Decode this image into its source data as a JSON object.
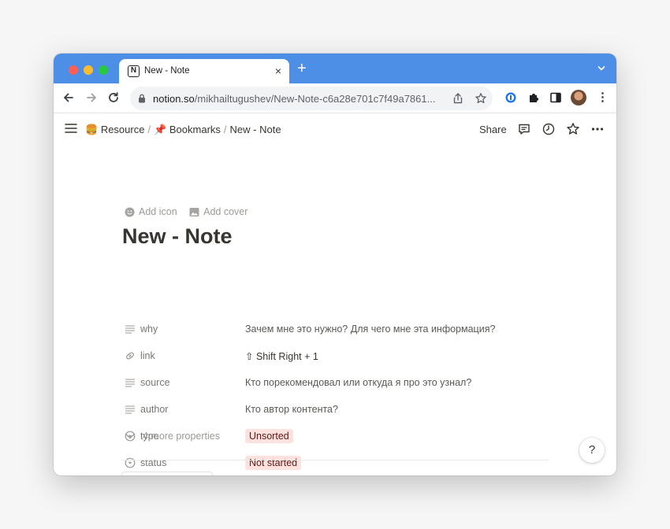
{
  "browser": {
    "tab": {
      "title": "New - Note",
      "favicon": "notion-icon",
      "close": "×"
    },
    "new_tab": "+",
    "url_host": "notion.so",
    "url_path": "/mikhailtugushev/New-Note-c6a28e701c7f49a7861..."
  },
  "header": {
    "breadcrumbs": [
      {
        "emoji": "🍔",
        "label": "Resource"
      },
      {
        "emoji": "📌",
        "label": "Bookmarks"
      },
      {
        "label": "New - Note"
      }
    ],
    "separator": "/",
    "share": "Share"
  },
  "page": {
    "add_icon": "Add icon",
    "add_cover": "Add cover",
    "title": "New - Note",
    "properties": [
      {
        "name": "why",
        "icon": "text-icon",
        "value": "Зачем мне это нужно? Для чего мне эта информация?"
      },
      {
        "name": "link",
        "icon": "link-icon",
        "value": "⇧ Shift Right + 1"
      },
      {
        "name": "source",
        "icon": "text-icon",
        "value": "Кто порекомендовал или откуда я про это узнал?"
      },
      {
        "name": "author",
        "icon": "text-icon",
        "value": "Кто автор контента?"
      },
      {
        "name": "type",
        "icon": "select-icon",
        "value": "Unsorted"
      },
      {
        "name": "status",
        "icon": "select-icon",
        "value": "Not started"
      }
    ],
    "more_properties": "4 more properties",
    "help": "?"
  },
  "colors": {
    "tabbar": "#4d8ee6",
    "tag_bg": "#ffe2dd",
    "tag_text": "#5d1715",
    "text": "#37352f",
    "muted": "#787774"
  }
}
